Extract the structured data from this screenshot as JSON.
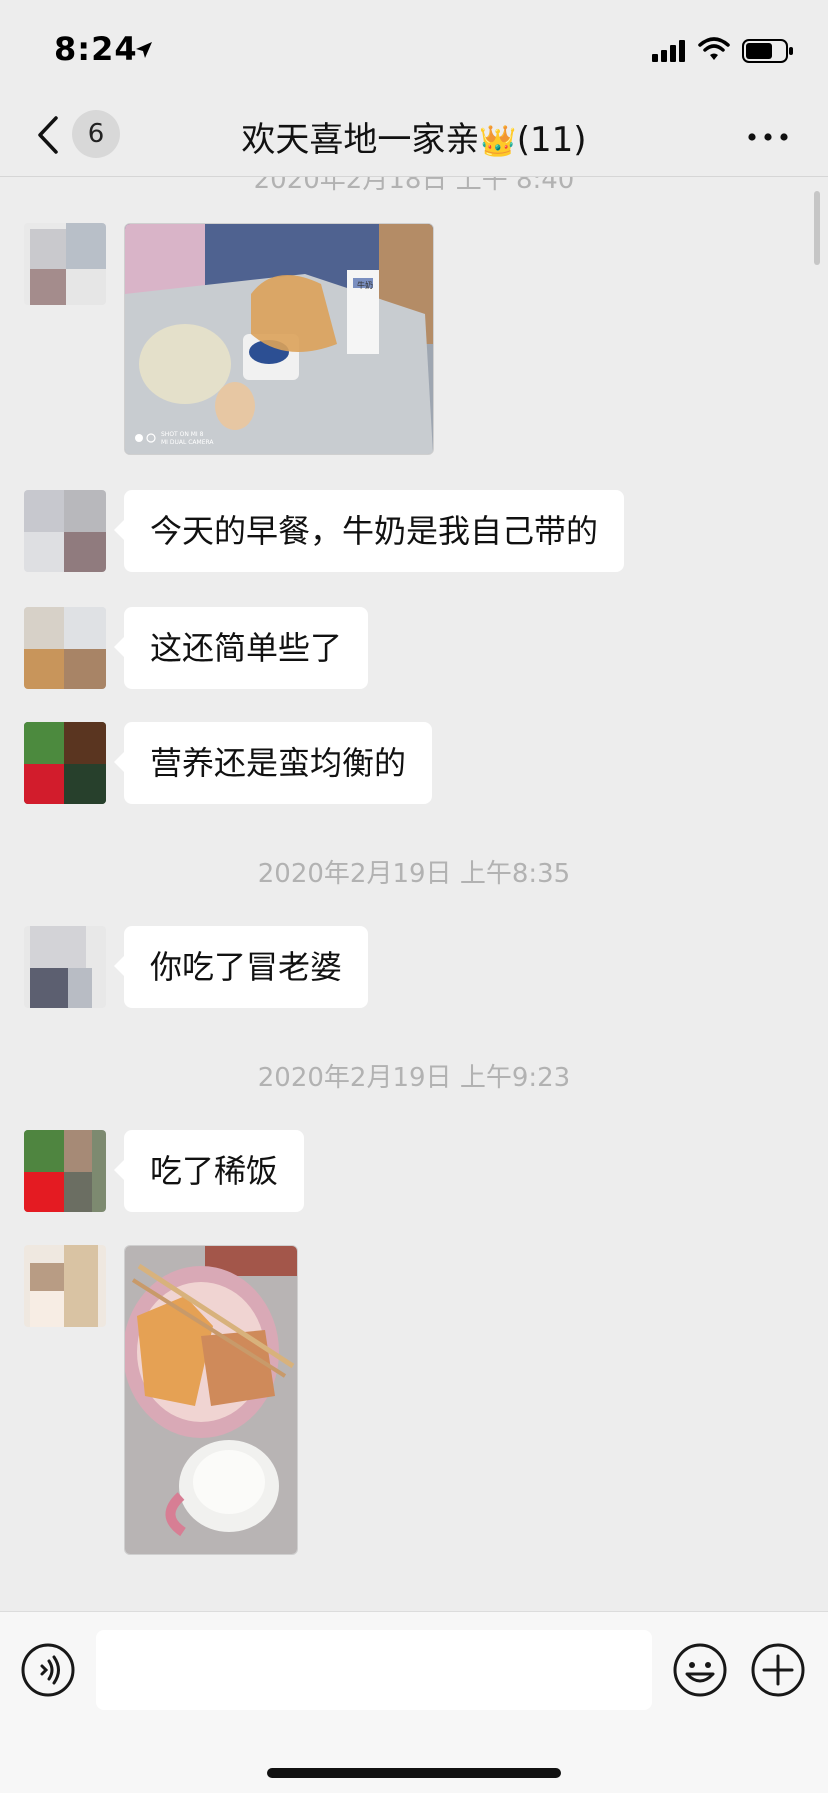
{
  "status": {
    "time": "8:24"
  },
  "nav": {
    "badge": "6",
    "title": "欢天喜地一家亲",
    "crown": "👑",
    "count": "(11)"
  },
  "chat": {
    "partial_timestamp": "2020年2月18日 上午 8:40",
    "messages": [
      {
        "type": "image",
        "image": {
          "caption": "SHOT ON MI 8",
          "caption2": "MI DUAL CAMERA",
          "carton_text": "牛奶"
        }
      },
      {
        "type": "text",
        "text": "今天的早餐，牛奶是我自己带的"
      },
      {
        "type": "text",
        "text": "这还简单些了"
      },
      {
        "type": "text",
        "text": "营养还是蛮均衡的"
      },
      {
        "type": "timestamp",
        "text": "2020年2月19日 上午8:35"
      },
      {
        "type": "text",
        "text": "你吃了冒老婆"
      },
      {
        "type": "timestamp",
        "text": "2020年2月19日 上午9:23"
      },
      {
        "type": "text",
        "text": "吃了稀饭"
      },
      {
        "type": "image"
      }
    ]
  },
  "icons": [
    "chevron-left-icon",
    "more-icon",
    "voice-icon",
    "emoji-icon",
    "plus-icon",
    "signal-icon",
    "wifi-icon",
    "battery-icon",
    "location-arrow-icon"
  ],
  "colors": {
    "background": "#ededed",
    "bubble": "#ffffff",
    "timestamp": "#b2b2b2",
    "input_bar": "#f7f7f7"
  }
}
